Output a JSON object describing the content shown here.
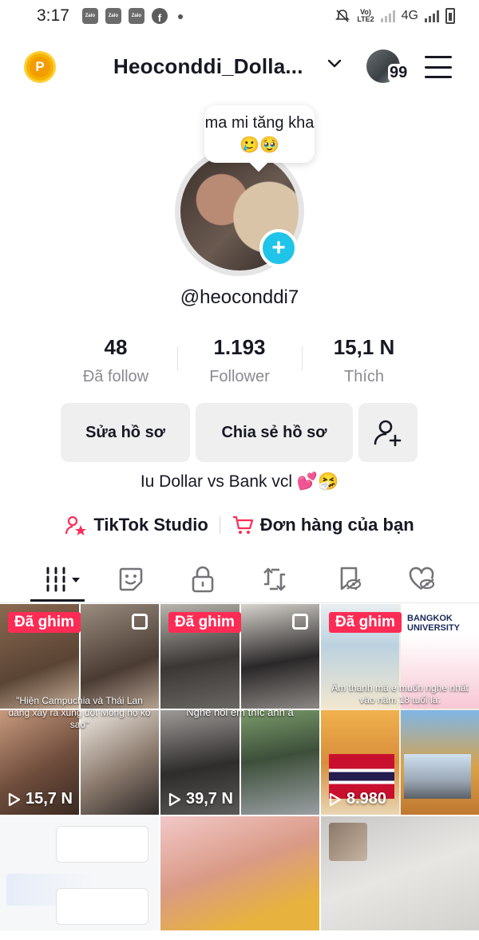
{
  "status_bar": {
    "time": "3:17",
    "notif_icons": [
      "Zalo",
      "Zalo",
      "Zalo"
    ],
    "network": "4G",
    "volte": "Vo) LTE2"
  },
  "header": {
    "username": "Heoconddi_Dolla...",
    "notification_count": "99"
  },
  "profile": {
    "note": "ma mi tăng kha🥲🥹",
    "handle": "@heoconddi7",
    "avatar_plus": "+"
  },
  "stats": [
    {
      "value": "48",
      "label": "Đã follow"
    },
    {
      "value": "1.193",
      "label": "Follower"
    },
    {
      "value": "15,1 N",
      "label": "Thích"
    }
  ],
  "buttons": {
    "edit": "Sửa hồ sơ",
    "share": "Chia sẻ hồ sơ"
  },
  "bio": "Iu Dollar vs Bank vcl 💕🤧",
  "links": {
    "studio": "TikTok Studio",
    "orders": "Đơn hàng của bạn"
  },
  "tabs": [
    "videos",
    "favorites",
    "private",
    "reposts",
    "saved",
    "liked"
  ],
  "videos": [
    {
      "pinned": "Đã ghim",
      "views": "15,7 N",
      "caption": "\"Hiện Campuchia và Thái Lan đang xảy ra xung đột Mong họ ko sao\""
    },
    {
      "pinned": "Đã ghim",
      "views": "39,7 N",
      "caption": "Nghe nói em thíc anh à"
    },
    {
      "pinned": "Đã ghim",
      "views": "8.980",
      "caption": "Âm thanh mà e muốn nghe nhất vào năm 18 tuổi là:",
      "top_label": "BANGKOK UNIVERSITY"
    },
    {
      "pinned": "",
      "views": "",
      "caption": ""
    },
    {
      "pinned": "",
      "views": "",
      "caption": ""
    },
    {
      "pinned": "",
      "views": "",
      "caption": ""
    }
  ],
  "colors": {
    "accent": "#fe2c55",
    "plus_badge": "#20c4e8",
    "button_bg": "#efeff0",
    "muted_text": "#8a8b91"
  }
}
